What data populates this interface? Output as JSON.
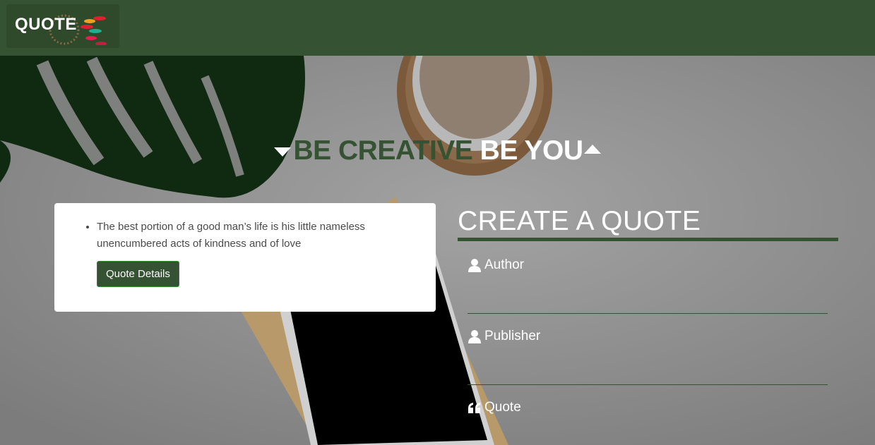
{
  "navbar": {
    "logo_text": "QUOTE"
  },
  "headline": {
    "part1": "BE CREATIVE",
    "part2": "BE YOU"
  },
  "quotes": [
    {
      "text": "The best portion of a good man’s life is his little nameless unencumbered acts of kindness and of love",
      "button_label": "Quote Details"
    }
  ],
  "form": {
    "title": "CREATE A QUOTE",
    "author_label": "Author",
    "publisher_label": "Publisher",
    "quote_label": "Quote"
  },
  "colors": {
    "brand_green": "#355232",
    "text_white": "#ffffff"
  },
  "icons": {
    "author": "user-icon",
    "publisher": "user-icon",
    "quote": "quote-left-icon",
    "headline_left": "caret-down-icon",
    "headline_right": "caret-up-icon"
  }
}
